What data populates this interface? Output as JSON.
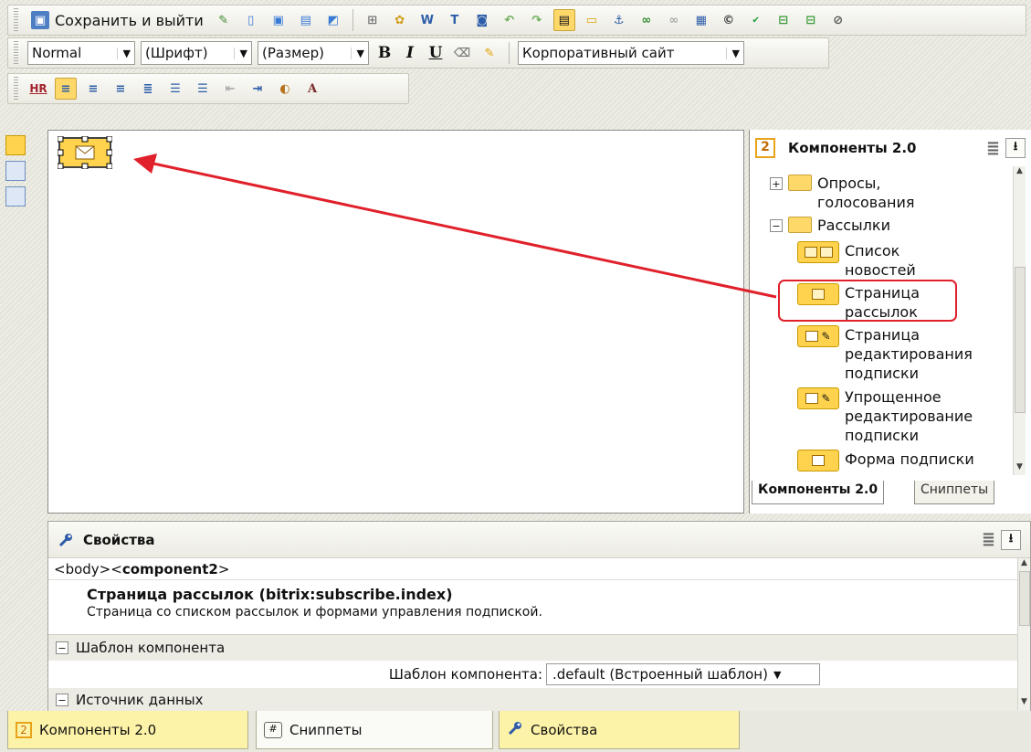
{
  "toolbar1": {
    "save_exit_label": "Сохранить и выйти"
  },
  "toolbar2": {
    "style_select": "Normal",
    "font_select": "(Шрифт)",
    "size_select": "(Размер)",
    "bold_label": "B",
    "italic_label": "I",
    "underline_label": "U",
    "template_select": "Корпоративный сайт"
  },
  "toolbar3": {
    "hr_label": "HR"
  },
  "components_panel": {
    "title": "Компоненты 2.0",
    "tree": [
      {
        "label": "Опросы, голосования",
        "type": "folder",
        "expanded": false
      },
      {
        "label": "Рассылки",
        "type": "folder",
        "expanded": true
      },
      {
        "label": "Список новостей",
        "type": "component",
        "icon": "newsletter-list-icon"
      },
      {
        "label": "Страница рассылок",
        "type": "component",
        "icon": "subscription-page-icon",
        "highlighted": true
      },
      {
        "label": "Страница редактирования подписки",
        "type": "component",
        "icon": "edit-subscription-icon"
      },
      {
        "label": "Упрощенное редактирование подписки",
        "type": "component",
        "icon": "simple-edit-subscription-icon"
      },
      {
        "label": "Форма подписки",
        "type": "component",
        "icon": "subscription-form-icon"
      }
    ],
    "tabs": [
      "Компоненты 2.0",
      "Сниппеты"
    ]
  },
  "properties": {
    "title": "Свойства",
    "tag_path_plain": "<body><",
    "tag_path_bold": "component2",
    "tag_path_end": ">",
    "component_title": "Страница рассылок (bitrix:subscribe.index)",
    "component_desc": "Страница со списком рассылок и формами управления подпиской.",
    "section_template": "Шаблон компонента",
    "template_label": "Шаблон компонента:",
    "template_value": ".default (Встроенный шаблон)",
    "section_source": "Источник данных"
  },
  "bottom_tabs": [
    "Компоненты 2.0",
    "Сниппеты",
    "Свойства"
  ],
  "colors": {
    "accent_red": "#e0202a",
    "component_yellow": "#ffd34d",
    "tab_yellow": "#fdf3a8"
  }
}
